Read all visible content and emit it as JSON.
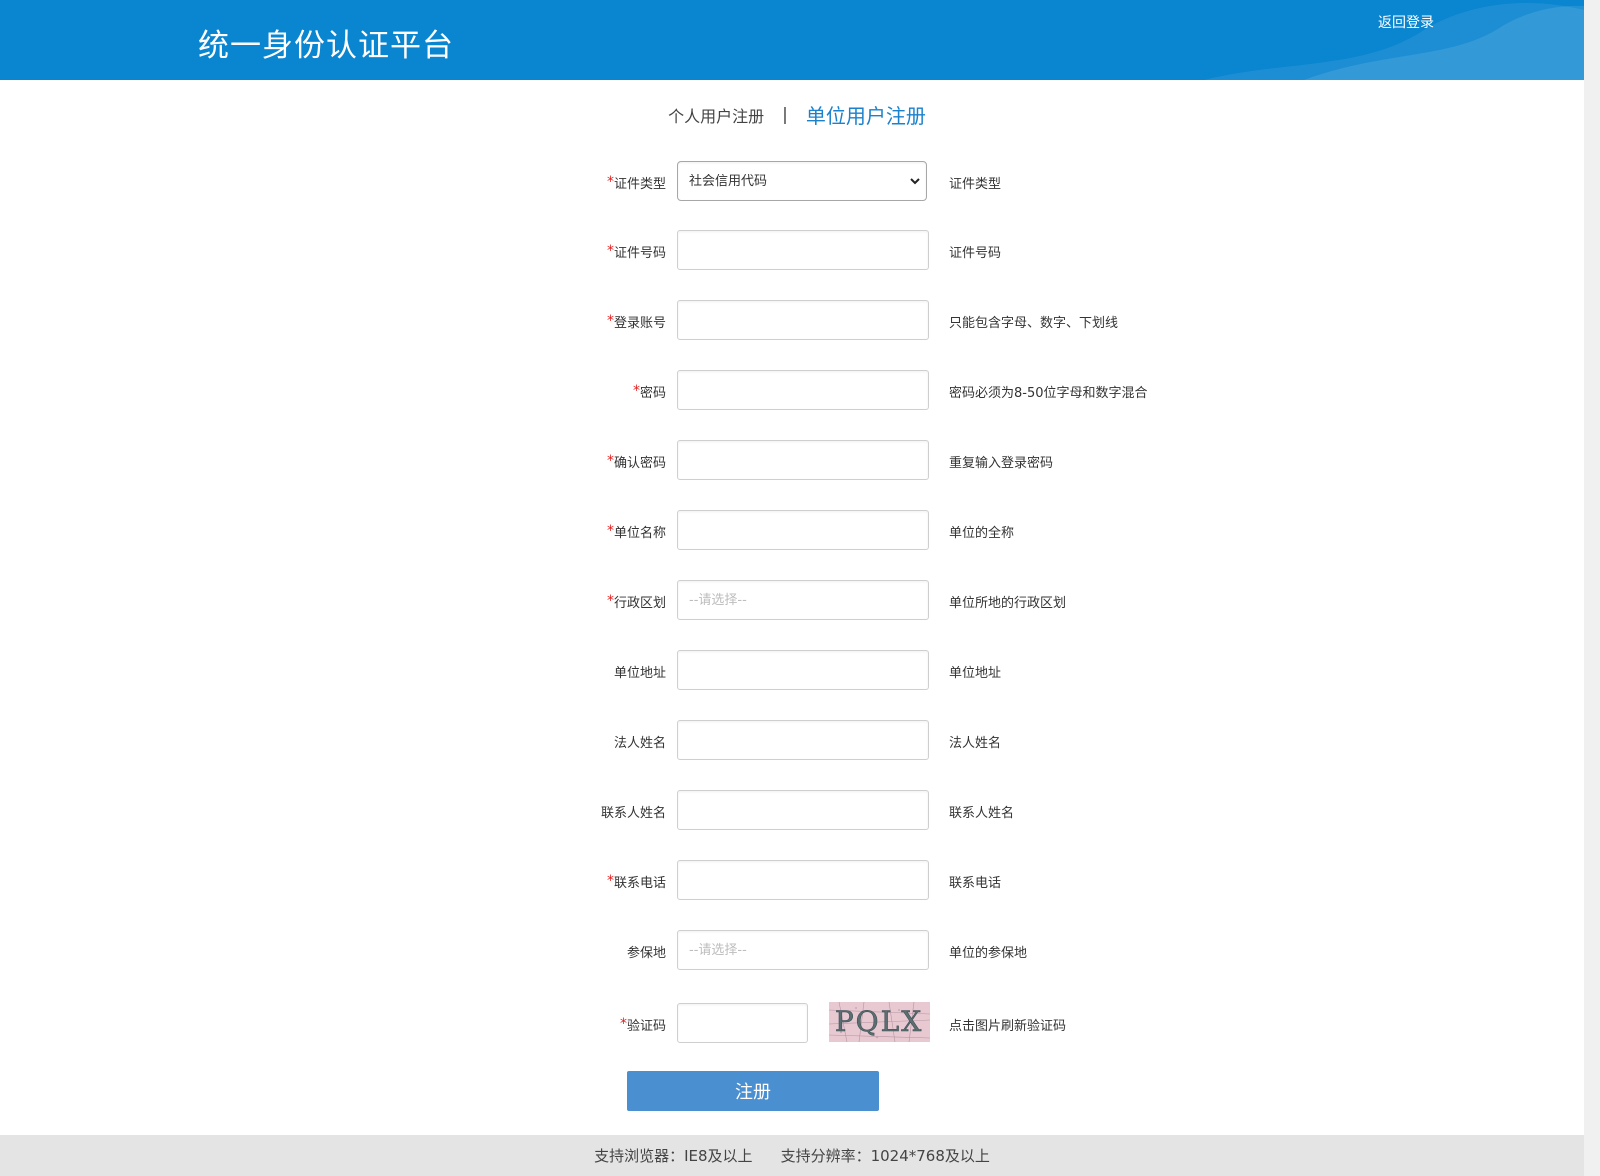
{
  "header": {
    "title": "统一身份认证平台",
    "back_login": "返回登录",
    "bg_color": "#0a85d0"
  },
  "tabs": {
    "personal": "个人用户注册",
    "separator": "|",
    "unit": "单位用户注册",
    "active_color": "#1a82cc"
  },
  "form": {
    "required_mark": "*",
    "cert_type": {
      "label": "证件类型",
      "value": "社会信用代码",
      "hint": "证件类型",
      "options": [
        "社会信用代码"
      ]
    },
    "cert_no": {
      "label": "证件号码",
      "hint": "证件号码"
    },
    "account": {
      "label": "登录账号",
      "hint": "只能包含字母、数字、下划线"
    },
    "password": {
      "label": "密码",
      "hint": "密码必须为8-50位字母和数字混合"
    },
    "confirm_password": {
      "label": "确认密码",
      "hint": "重复输入登录密码"
    },
    "unit_name": {
      "label": "单位名称",
      "hint": "单位的全称"
    },
    "region": {
      "label": "行政区划",
      "placeholder": "--请选择--",
      "hint": "单位所地的行政区划"
    },
    "unit_address": {
      "label": "单位地址",
      "hint": "单位地址"
    },
    "legal_person": {
      "label": "法人姓名",
      "hint": "法人姓名"
    },
    "contact_name": {
      "label": "联系人姓名",
      "hint": "联系人姓名"
    },
    "contact_phone": {
      "label": "联系电话",
      "hint": "联系电话"
    },
    "insured_place": {
      "label": "参保地",
      "placeholder": "--请选择--",
      "hint": "单位的参保地"
    },
    "captcha": {
      "label": "验证码",
      "image_text": "PQLX",
      "hint": "点击图片刷新验证码"
    },
    "submit": "注册"
  },
  "footer": {
    "browser": "支持浏览器：IE8及以上",
    "resolution": "支持分辨率：1024*768及以上"
  },
  "colors": {
    "required": "#e02020",
    "submit_bg": "#4a8fd0"
  }
}
